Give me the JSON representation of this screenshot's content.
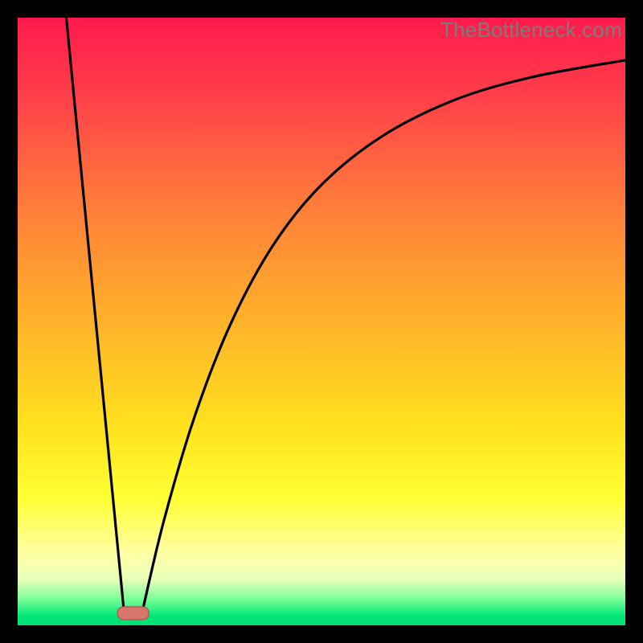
{
  "watermark": "TheBottleneck.com",
  "chart_data": {
    "type": "line",
    "title": "",
    "xlabel": "",
    "ylabel": "",
    "xlim": [
      0,
      100
    ],
    "ylim": [
      0,
      100
    ],
    "background_gradient": {
      "stops": [
        {
          "pos": 0.0,
          "color": "#ff1a4b"
        },
        {
          "pos": 0.12,
          "color": "#ff3c4b"
        },
        {
          "pos": 0.3,
          "color": "#ff7a3a"
        },
        {
          "pos": 0.5,
          "color": "#ffb22a"
        },
        {
          "pos": 0.68,
          "color": "#ffe31e"
        },
        {
          "pos": 0.79,
          "color": "#ffff33"
        },
        {
          "pos": 0.885,
          "color": "#ffffa8"
        },
        {
          "pos": 0.925,
          "color": "#e8ffb8"
        },
        {
          "pos": 0.955,
          "color": "#80ff9a"
        },
        {
          "pos": 0.985,
          "color": "#00e878"
        },
        {
          "pos": 1.0,
          "color": "#00e070"
        }
      ]
    },
    "series": [
      {
        "name": "bottleneck-curve",
        "segments": [
          {
            "type": "line",
            "points": [
              {
                "x": 8.0,
                "y": 100.0
              },
              {
                "x": 17.5,
                "y": 2.2
              }
            ]
          },
          {
            "type": "curve",
            "points": [
              {
                "x": 20.5,
                "y": 2.2
              },
              {
                "x": 24.0,
                "y": 17.0
              },
              {
                "x": 29.0,
                "y": 34.0
              },
              {
                "x": 35.0,
                "y": 49.5
              },
              {
                "x": 42.0,
                "y": 62.5
              },
              {
                "x": 50.0,
                "y": 72.5
              },
              {
                "x": 60.0,
                "y": 80.5
              },
              {
                "x": 72.0,
                "y": 86.5
              },
              {
                "x": 85.0,
                "y": 90.3
              },
              {
                "x": 100.0,
                "y": 93.0
              }
            ]
          }
        ]
      }
    ],
    "marker": {
      "name": "optimal-range-pill",
      "x_center": 19.0,
      "y": 2.0,
      "width": 5.2,
      "height": 2.1,
      "fill": "#d9766c",
      "stroke": "#b25a52"
    }
  }
}
